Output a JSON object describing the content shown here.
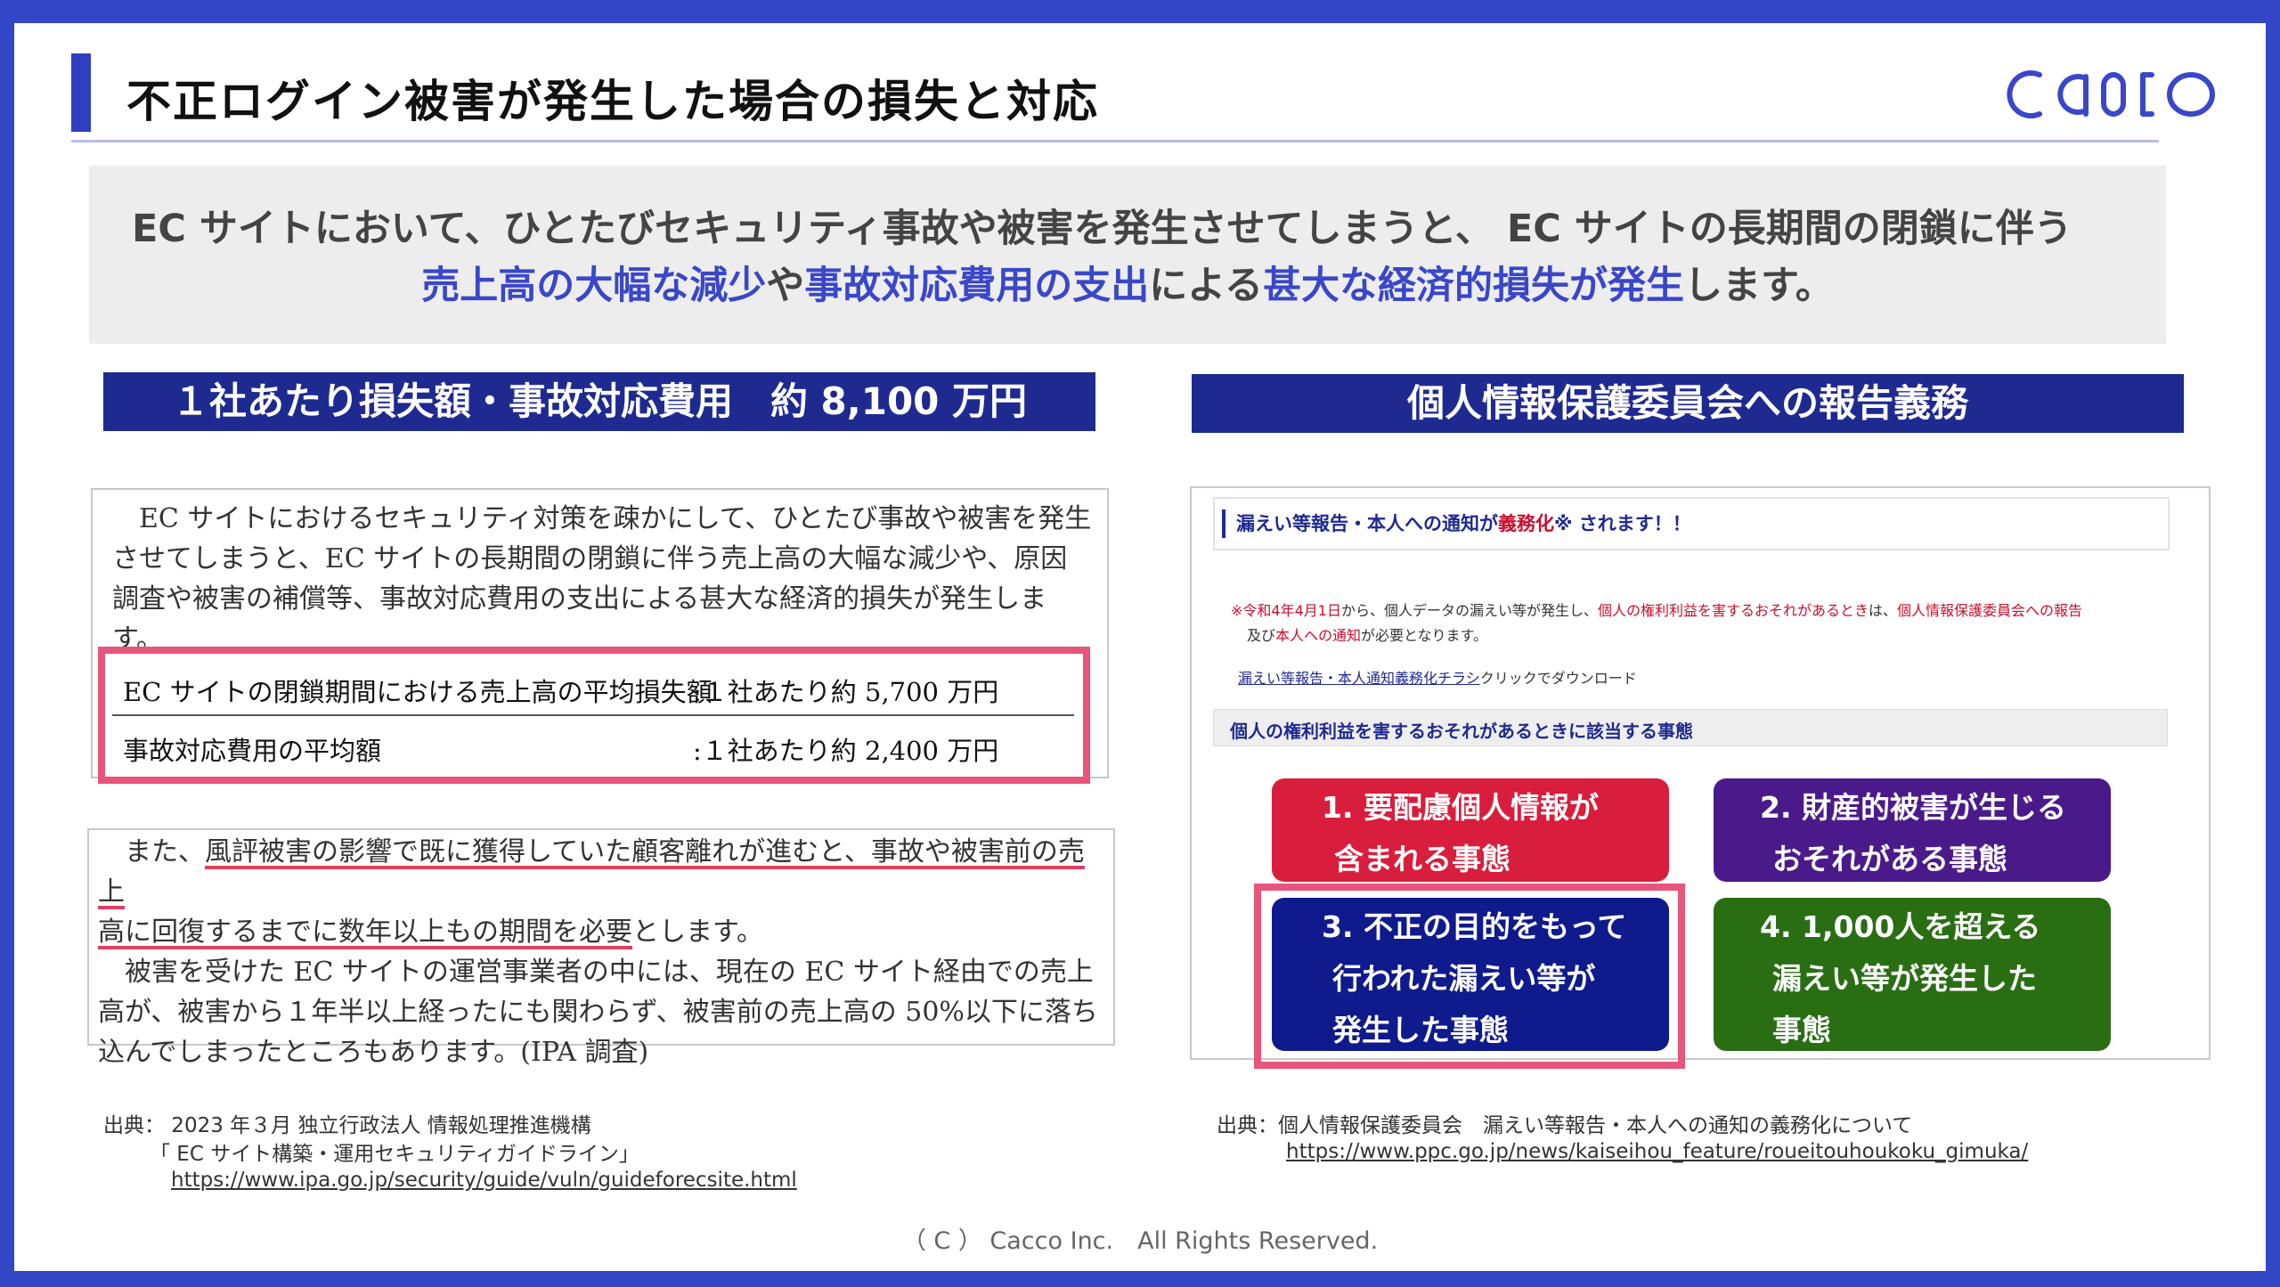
{
  "slide": {
    "title": "不正ログイン被害が発生した場合の損失と対応",
    "logo_text": "cacco"
  },
  "lead": {
    "line1": "EC サイトにおいて、ひとたびセキュリティ事故や被害を発生させてしまうと、 EC サイトの長期間の閉鎖に伴う",
    "line2_parts": [
      "売上高の大幅な減少",
      "や",
      "事故対応費用の支出",
      "による",
      "甚大な経済的損失が発生",
      "します。"
    ]
  },
  "left": {
    "header": "１社あたり損失額・事故対応費用　約 8,100 万円",
    "paragraph1": "　EC サイトにおけるセキュリティ対策を疎かにして、ひとたび事故や被害を発生させてしまうと、EC サイトの長期間の閉鎖に伴う売上高の大幅な減少や、原因調査や被害の補償等、事故対応費用の支出による甚大な経済的損失が発生します。",
    "rows": [
      {
        "label": "EC サイトの閉鎖期間における売上高の平均損失額",
        "value": ":１社あたり約 5,700 万円"
      },
      {
        "label": "事故対応費用の平均額",
        "value": ":１社あたり約 2,400 万円"
      }
    ],
    "paragraph2_pre": "　また、",
    "paragraph2_ul1": "風評被害の影響で既に獲得していた顧客離れが進むと、事故や被害前の売上",
    "paragraph2_ul2": "高に回復するまでに数年以上もの期間を必要",
    "paragraph2_post": "とします。",
    "paragraph3": "　被害を受けた EC サイトの運営事業者の中には、現在の EC サイト経由での売上高が、被害から１年半以上経ったにも関わらず、被害前の売上高の 50%以下に落ち込んでしまったところもあります。(IPA 調査)",
    "source_line1": "出典： 2023 年３月 独立行政法人 情報処理推進機構",
    "source_line2": "「 EC サイト構築・運用セキュリティガイドライン」",
    "source_url": "https://www.ipa.go.jp/security/guide/vuln/guideforecsite.html"
  },
  "right": {
    "header": "個人情報保護委員会への報告義務",
    "notice_pre": "漏えい等報告・本人への通知が",
    "notice_red": "義務化",
    "notice_post": "※ されます！！",
    "note_line1_parts": [
      "※令和4年4月1日",
      "から、個人データの漏えい等が発生し、",
      "個人の権利利益を害するおそれがあるとき",
      "は、",
      "個人情報保護委員会への報告"
    ],
    "note_line2_parts": [
      "及び",
      "本人への通知",
      "が必要となります。"
    ],
    "download_link": "漏えい等報告・本人通知義務化チラシ",
    "download_suffix": "クリックでダウンロード",
    "gray_heading": "個人の権利利益を害するおそれがあるときに該当する事態",
    "cards": [
      {
        "lines": [
          "1.  要配慮個人情報が",
          "含まれる事態"
        ],
        "color": "#d81e3c"
      },
      {
        "lines": [
          "2.  財産的被害が生じる",
          "おそれがある事態"
        ],
        "color": "#4b1a8a"
      },
      {
        "lines": [
          "3.  不正の目的をもって",
          "行われた漏えい等が",
          "発生した事態"
        ],
        "color": "#0f1a8c"
      },
      {
        "lines": [
          "4.  1,000人を超える",
          "漏えい等が発生した",
          "事態"
        ],
        "color": "#2a6e14"
      }
    ],
    "source_line1": "出典：個人情報保護委員会　漏えい等報告・本人への通知の義務化について",
    "source_url": "https://www.ppc.go.jp/news/kaiseihou_feature/roueitouhoukoku_gimuka/"
  },
  "footer": "（ C ） Cacco Inc.　All Rights Reserved.",
  "colors": {
    "frame": "#3346c6",
    "header_navy": "#1f2a91",
    "highlight_pink": "#e8557a",
    "lead_blue": "#3a47c9"
  }
}
